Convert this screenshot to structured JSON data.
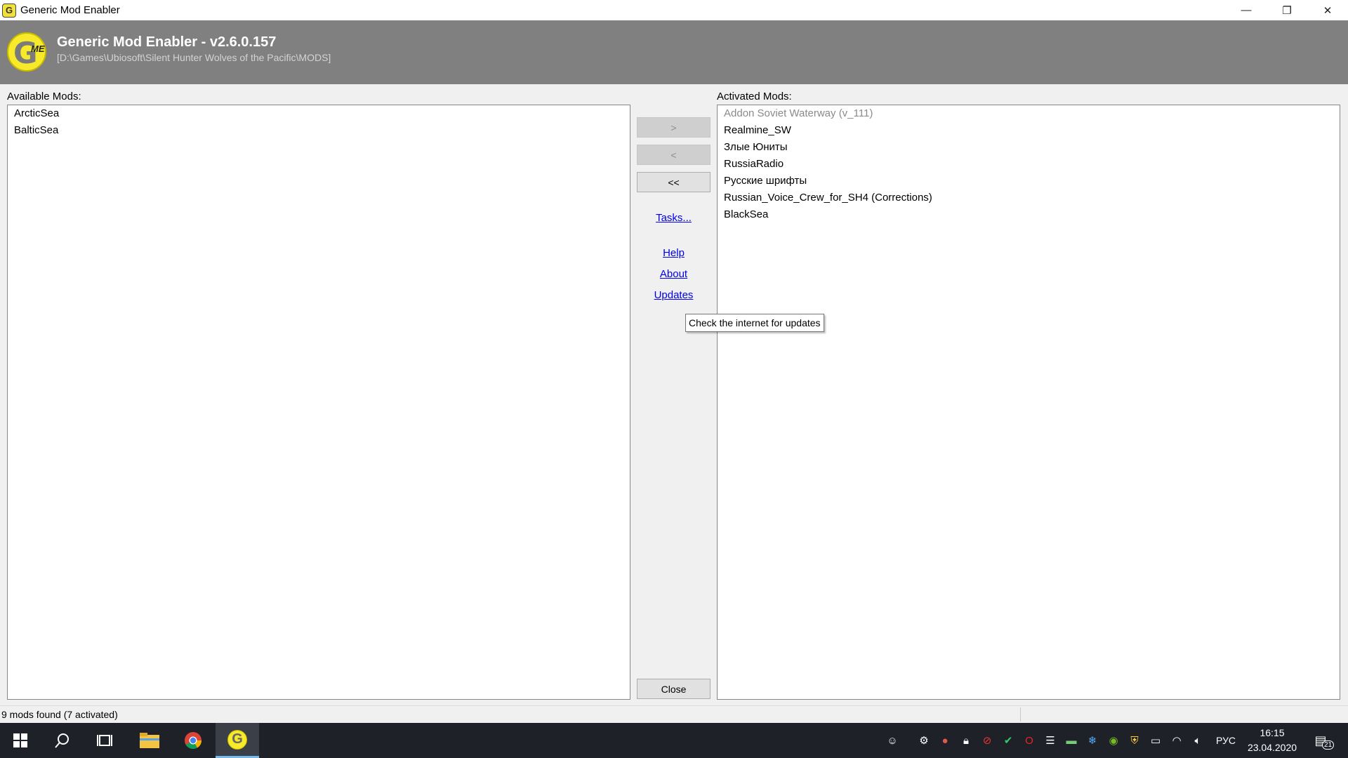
{
  "window": {
    "title": "Generic Mod Enabler",
    "controls": {
      "minimize": "—",
      "restore": "❐",
      "close": "✕"
    }
  },
  "header": {
    "app_name": "Generic Mod Enabler - v2.6.0.157",
    "path": "[D:\\Games\\Ubiosoft\\Silent Hunter Wolves of the Pacific\\MODS]",
    "logo_letter": "G",
    "logo_sub": "ME"
  },
  "available": {
    "label": "Available Mods:",
    "items": [
      "ArcticSea",
      "BalticSea"
    ]
  },
  "activated": {
    "label": "Activated Mods:",
    "items": [
      "Addon Soviet Waterway (v_111)",
      "Realmine_SW",
      "Злые Юниты",
      "RussiaRadio",
      "Русские шрифты",
      "Russian_Voice_Crew_for_SH4 (Corrections)",
      "BlackSea"
    ]
  },
  "controls": {
    "activate": ">",
    "deactivate": "<",
    "deactivate_all": "<<",
    "tasks": "Tasks...",
    "help": "Help",
    "about": "About",
    "updates": "Updates",
    "close": "Close"
  },
  "tooltip": "Check the internet for updates",
  "status": "9 mods found (7 activated)",
  "taskbar": {
    "language": "РУС",
    "time": "16:15",
    "date": "23.04.2020",
    "notifications": "21"
  }
}
